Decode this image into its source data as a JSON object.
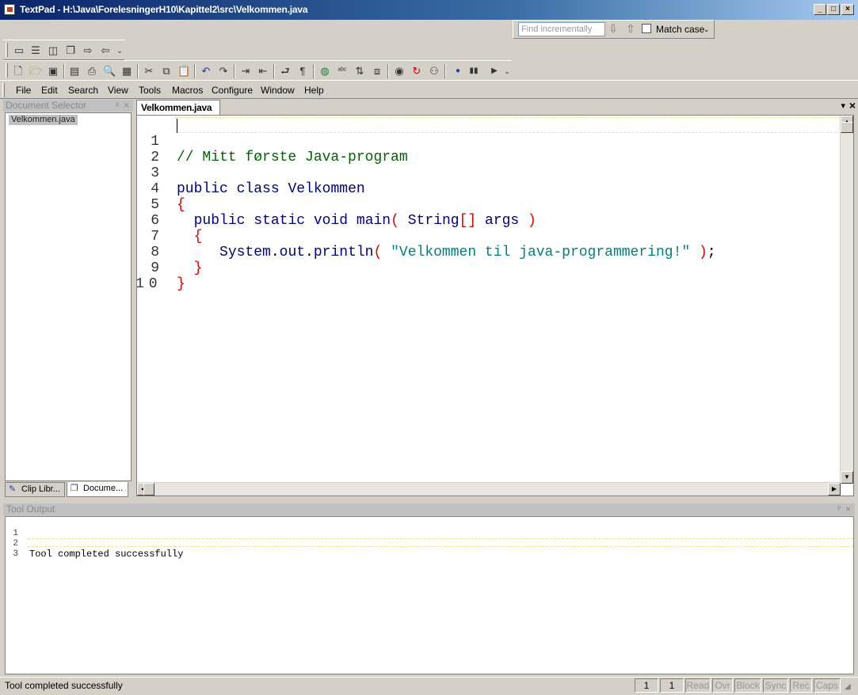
{
  "window": {
    "title": "TextPad - H:\\Java\\ForelesningerH10\\Kapittel2\\src\\Velkommen.java",
    "minimize": "_",
    "maximize": "□",
    "close": "×"
  },
  "find": {
    "placeholder": "Find incrementally",
    "down_arrow": "⇩",
    "up_arrow": "⇧",
    "match_case_label": "Match case",
    "dropdown": "⌄"
  },
  "menu": {
    "file": "File",
    "edit": "Edit",
    "search": "Search",
    "view": "View",
    "tools": "Tools",
    "macros": "Macros",
    "configure": "Configure",
    "window": "Window",
    "help": "Help"
  },
  "document_selector": {
    "title": "Document Selector",
    "pin": "ᵖ",
    "close": "×",
    "items": [
      "Velkommen.java"
    ],
    "tabs": [
      "Clip Libr...",
      "Docume..."
    ]
  },
  "editor": {
    "tab_label": "Velkommen.java",
    "tab_menu": "▾",
    "tab_close": "×",
    "lines": [
      {
        "num": "1",
        "text": "// Mitt første Java-program"
      },
      {
        "num": "2",
        "text": ""
      },
      {
        "num": "3",
        "text": "public class Velkommen"
      },
      {
        "num": "4",
        "text": "{"
      },
      {
        "num": "5",
        "text": "public static void main( String[] args )"
      },
      {
        "num": "6",
        "text": "{"
      },
      {
        "num": "7",
        "text": "System.out.println( \"Velkommen til java-programmering!\" );"
      },
      {
        "num": "8",
        "text": "}"
      },
      {
        "num": "9",
        "text": "}"
      },
      {
        "num": "10",
        "text": ""
      }
    ]
  },
  "tool_output": {
    "title": "Tool Output",
    "lines": [
      {
        "num": "1",
        "text": ""
      },
      {
        "num": "2",
        "text": "Tool completed successfully"
      },
      {
        "num": "3",
        "text": ""
      }
    ]
  },
  "status": {
    "message": "Tool completed successfully",
    "line": "1",
    "column": "1",
    "read": "Read",
    "ovr": "Ovr",
    "block": "Block",
    "sync": "Sync",
    "rec": "Rec",
    "caps": "Caps"
  },
  "colors": {
    "keyword": "#00008b",
    "comment": "#006400",
    "bracket": "#e00000",
    "string": "#008080"
  }
}
